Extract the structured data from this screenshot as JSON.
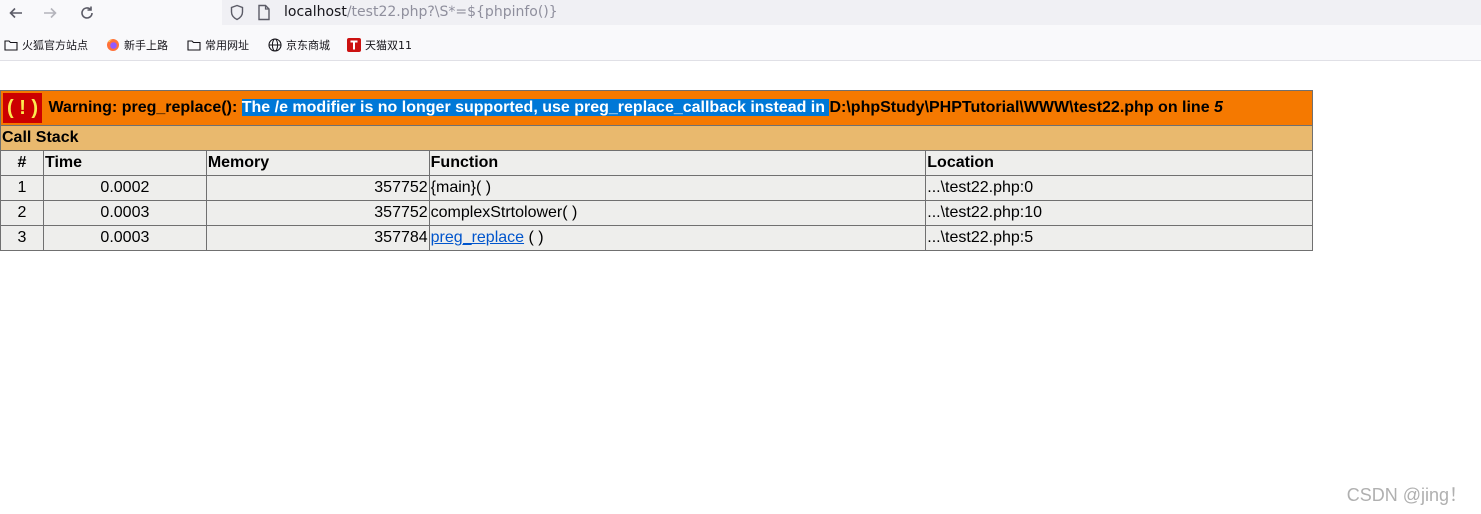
{
  "browser": {
    "url_host": "localhost",
    "url_path": "/test22.php?\\S*=${phpinfo()}"
  },
  "bookmarks": [
    {
      "label": "火狐官方站点",
      "icon": "folder-icon"
    },
    {
      "label": "新手上路",
      "icon": "firefox-icon"
    },
    {
      "label": "常用网址",
      "icon": "folder-icon"
    },
    {
      "label": "京东商城",
      "icon": "globe-icon"
    },
    {
      "label": "天猫双11",
      "icon": "tmall-icon"
    }
  ],
  "error": {
    "icon_text": "( ! )",
    "prefix": " Warning: preg_replace(): ",
    "selected_message": "The /e modifier is no longer supported, use preg_replace_callback instead in ",
    "path": "D:\\phpStudy\\PHPTutorial\\WWW\\test22.php on line ",
    "line": "5",
    "call_stack_label": "Call Stack",
    "headers": [
      "#",
      "Time",
      "Memory",
      "Function",
      "Location"
    ],
    "rows": [
      {
        "num": "1",
        "time": "0.0002",
        "memory": "357752",
        "function": "{main}( )",
        "is_link": false,
        "location": "...\\test22.php:0"
      },
      {
        "num": "2",
        "time": "0.0003",
        "memory": "357752",
        "function": "complexStrtolower( )",
        "is_link": false,
        "location": "...\\test22.php:10"
      },
      {
        "num": "3",
        "time": "0.0003",
        "memory": "357784",
        "function_link": "preg_replace",
        "function_suffix": " ( )",
        "is_link": true,
        "location": "...\\test22.php:5"
      }
    ]
  },
  "watermark": "CSDN @jing！",
  "colors": {
    "warning_bg": "#f57900",
    "callstack_bg": "#e9b96e",
    "cell_bg": "#eeeeec",
    "icon_bg": "#cc0000",
    "selection": "#0078d7"
  }
}
